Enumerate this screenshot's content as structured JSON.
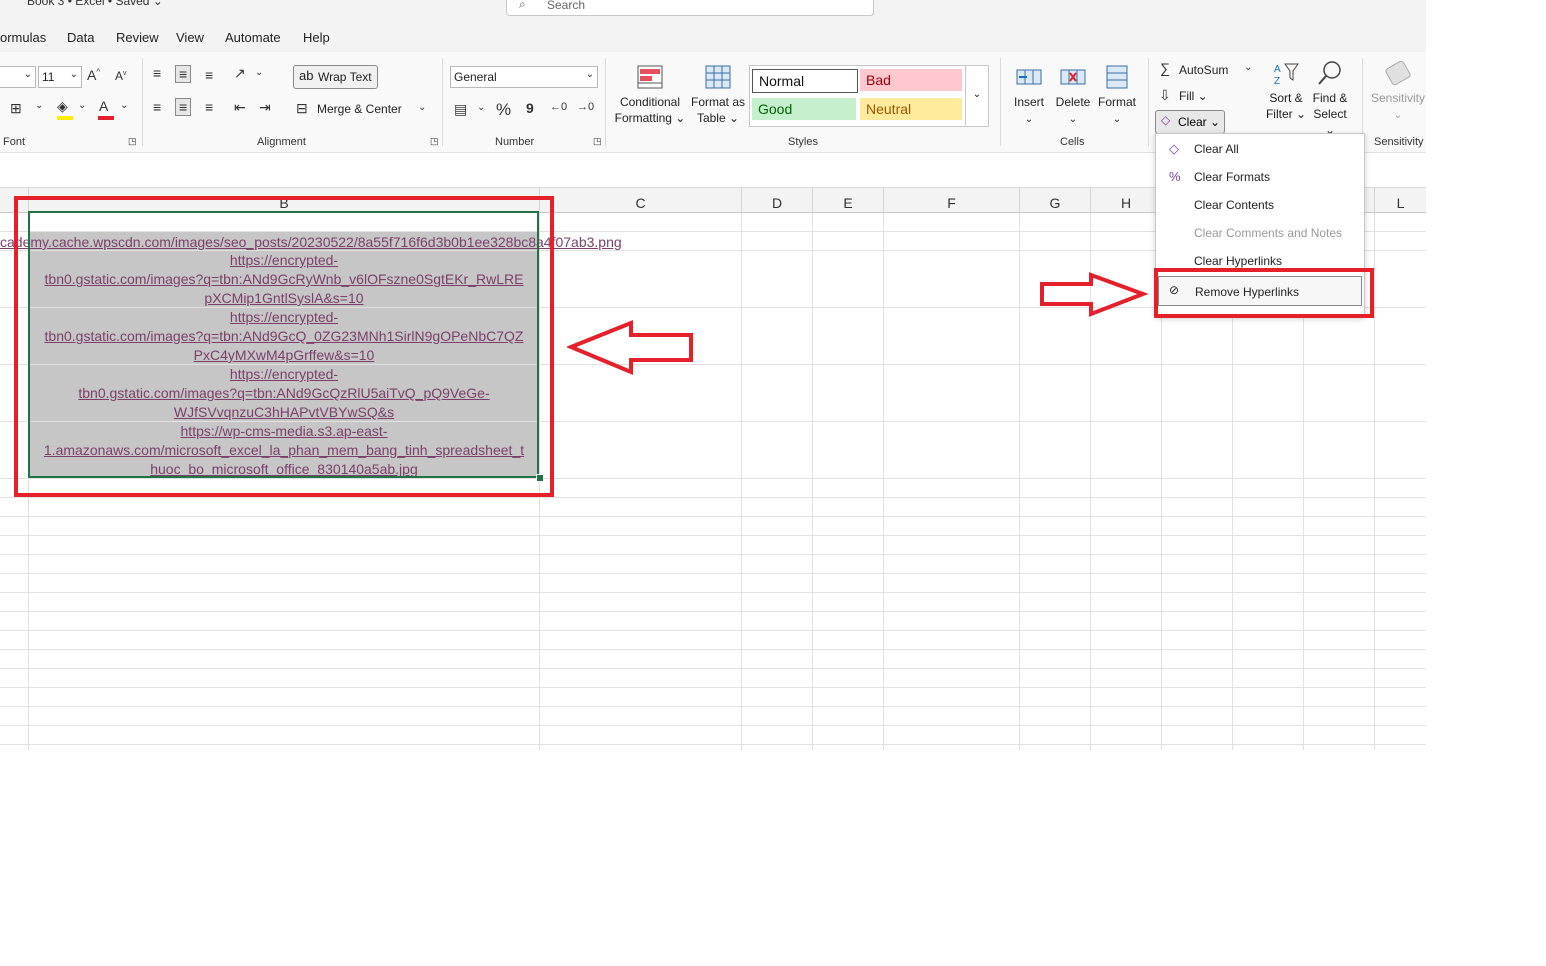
{
  "titlebar": {
    "title": "Book 3 • Excel • Saved ⌄",
    "search_placeholder": "Search"
  },
  "menu": [
    "ormulas",
    "Data",
    "Review",
    "View",
    "Automate",
    "Help"
  ],
  "font": {
    "size": "11",
    "group_label": "Font"
  },
  "alignment": {
    "wrap_text": "Wrap Text",
    "merge_center": "Merge & Center",
    "group_label": "Alignment"
  },
  "number": {
    "format": "General",
    "group_label": "Number",
    "percent": "%",
    "comma": "9"
  },
  "styles": {
    "conditional_line1": "Conditional",
    "conditional_line2": "Formatting ⌄",
    "format_table_line1": "Format as",
    "format_table_line2": "Table ⌄",
    "normal": "Normal",
    "bad": "Bad",
    "good": "Good",
    "neutral": "Neutral",
    "group_label": "Styles"
  },
  "cells": {
    "insert": "Insert",
    "delete": "Delete",
    "format": "Format",
    "group_label": "Cells"
  },
  "editing": {
    "autosum": "AutoSum",
    "fill": "Fill ⌄",
    "clear": "Clear ⌄",
    "sort_line1": "Sort &",
    "sort_line2": "Filter ⌄",
    "find_line1": "Find &",
    "find_line2": "Select ⌄"
  },
  "sensitivity": {
    "label": "Sensitivity",
    "group_label": "Sensitivity"
  },
  "columns": [
    "B",
    "C",
    "D",
    "E",
    "F",
    "G",
    "H",
    "L"
  ],
  "cells_data": {
    "row1": "cademy.cache.wpscdn.com/images/seo_posts/20230522/8a55f716f6d3b0b1ee328bc8a4f07ab3.png",
    "b2": [
      "https://encrypted-",
      "tbn0.gstatic.com/images?q=tbn:ANd9GcRyWnb_v6lOFszne0SgtEKr_RwLRE",
      "pXCMip1GntlSyslA&s=10"
    ],
    "b3": [
      "https://encrypted-",
      "tbn0.gstatic.com/images?q=tbn:ANd9GcQ_0ZG23MNh1SirlN9gOPeNbC7QZ",
      "PxC4yMXwM4pGrffew&s=10"
    ],
    "b4": [
      "https://encrypted-",
      "tbn0.gstatic.com/images?q=tbn:ANd9GcQzRlU5aiTvQ_pQ9VeGe-",
      "WJfSVvqnzuC3hHAPvtVBYwSQ&s"
    ],
    "b5": [
      "https://wp-cms-media.s3.ap-east-",
      "1.amazonaws.com/microsoft_excel_la_phan_mem_bang_tinh_spreadsheet_t",
      "huoc_bo_microsoft_office_830140a5ab.jpg"
    ]
  },
  "clear_menu": {
    "clear_all": "Clear All",
    "clear_formats": "Clear Formats",
    "clear_contents": "Clear Contents",
    "clear_comments": "Clear Comments and Notes",
    "clear_hyperlinks": "Clear Hyperlinks",
    "remove_hyperlinks": "Remove Hyperlinks"
  },
  "colors": {
    "accent_green": "#217346",
    "annotation_red": "#e5202b",
    "link": "#7b3f6a",
    "bad_bg": "#ffc7ce",
    "good_bg": "#c6efce",
    "neutral_bg": "#ffeb9c"
  }
}
